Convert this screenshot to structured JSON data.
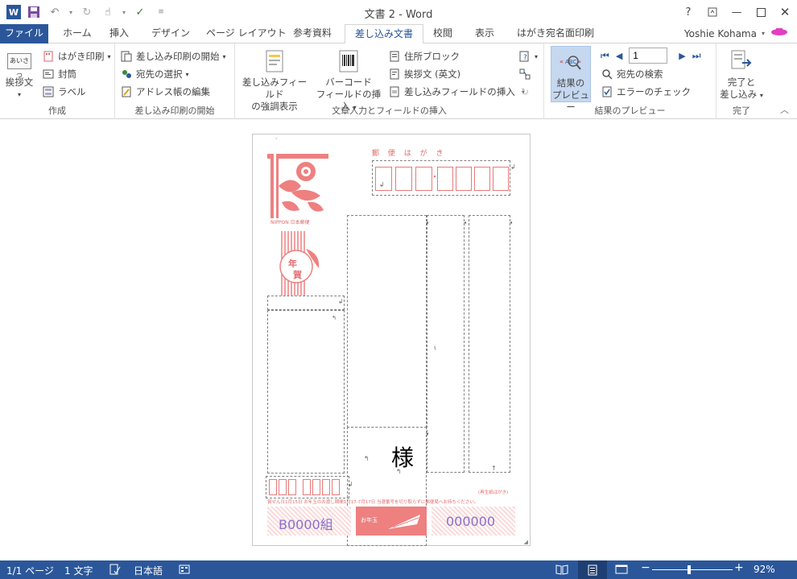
{
  "window": {
    "title": "文書 2 - Word",
    "help": "?",
    "user": "Yoshie Kohama"
  },
  "tabs": [
    "ファイル",
    "ホーム",
    "挿入",
    "デザイン",
    "ページ レイアウト",
    "参考資料",
    "差し込み文書",
    "校閲",
    "表示",
    "はがき宛名面印刷"
  ],
  "active_tab": "差し込み文書",
  "ribbon": {
    "create": {
      "label": "作成",
      "greeting_big": "挨拶文",
      "greeting_icon_text": "あいさつ",
      "postcard_print": "はがき印刷",
      "envelope": "封筒",
      "label_btn": "ラベル"
    },
    "start_merge": {
      "label": "差し込み印刷の開始",
      "start": "差し込み印刷の開始",
      "select_recipients": "宛先の選択",
      "edit_address_book": "アドレス帳の編集"
    },
    "write_insert": {
      "label": "文章入力とフィールドの挿入",
      "highlight_line1": "差し込みフィールド",
      "highlight_line2": "の強調表示",
      "barcode_line1": "バーコード",
      "barcode_line2": "フィールドの挿入",
      "address_block": "住所ブロック",
      "greeting_en": "挨拶文 (英文)",
      "insert_merge_field": "差し込みフィールドの挿入"
    },
    "preview": {
      "label": "結果のプレビュー",
      "preview_line1": "結果の",
      "preview_line2": "プレビュー",
      "record_value": "1",
      "find_recipient": "宛先の検索",
      "check_errors": "エラーのチェック"
    },
    "finish": {
      "label": "完了",
      "finish_line1": "完了と",
      "finish_line2": "差し込み"
    }
  },
  "postcard": {
    "header": "郵 便 は が き",
    "brand": "NIPPON 日本郵便",
    "stamp_text_1": "年",
    "stamp_text_2": "賀",
    "honorific": "様",
    "lottery_label": "(再生紙はがき)",
    "lottery_note": "賞せん日1月15日 お年玉のお渡し期間1月17-7月17日 当選番号を切り取らずに郵便局へお持ちください。",
    "group_code": "B0000組",
    "serial": "000000",
    "otoshidama": "お年玉"
  },
  "statusbar": {
    "page": "1/1 ページ",
    "words": "1 文字",
    "language": "日本語",
    "zoom": "92%",
    "zoom_level": 0.92
  }
}
